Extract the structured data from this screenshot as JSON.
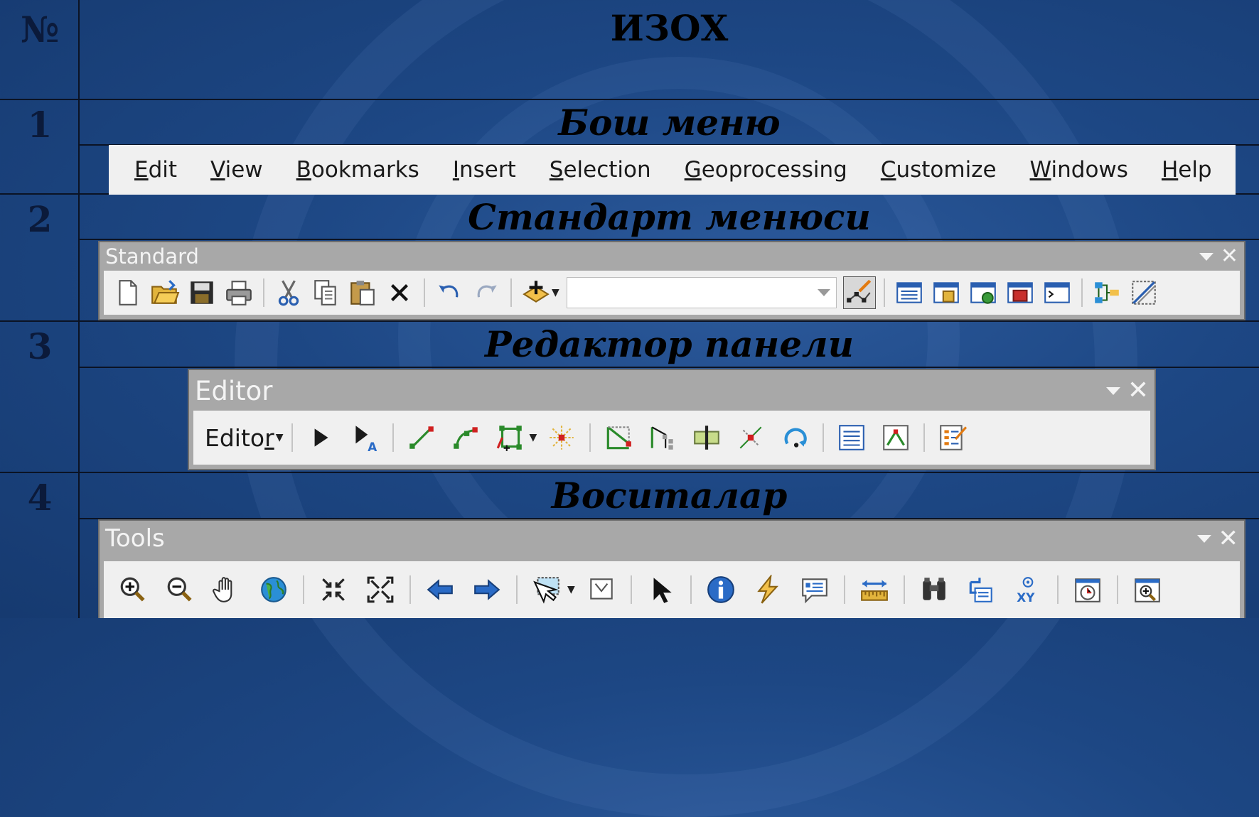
{
  "header": {
    "num_label": "№",
    "title": "ИЗОХ"
  },
  "rows": [
    {
      "num": "1",
      "title": "Бош меню"
    },
    {
      "num": "2",
      "title": "Стандарт менюси"
    },
    {
      "num": "3",
      "title": "Редактор панели"
    },
    {
      "num": "4",
      "title": "Воситалар"
    }
  ],
  "menubar": {
    "items": [
      {
        "u": "E",
        "rest": "dit"
      },
      {
        "u": "V",
        "rest": "iew"
      },
      {
        "u": "B",
        "rest": "ookmarks"
      },
      {
        "u": "I",
        "rest": "nsert"
      },
      {
        "u": "S",
        "rest": "election"
      },
      {
        "u": "G",
        "rest": "eoprocessing"
      },
      {
        "u": "C",
        "rest": "ustomize"
      },
      {
        "u": "W",
        "rest": "indows"
      },
      {
        "u": "H",
        "rest": "elp"
      }
    ]
  },
  "standard_toolbar": {
    "title": "Standard",
    "combo_value": ""
  },
  "editor_toolbar": {
    "title": "Editor",
    "menu_label_pre": "Edito",
    "menu_label_u": "r"
  },
  "tools_toolbar": {
    "title": "Tools"
  },
  "colors": {
    "background": "#1d4784",
    "toolbar_title_bar": "#a8a8a8",
    "toolbar_body": "#f0f0f0",
    "menubar": "#f0f0f0"
  }
}
